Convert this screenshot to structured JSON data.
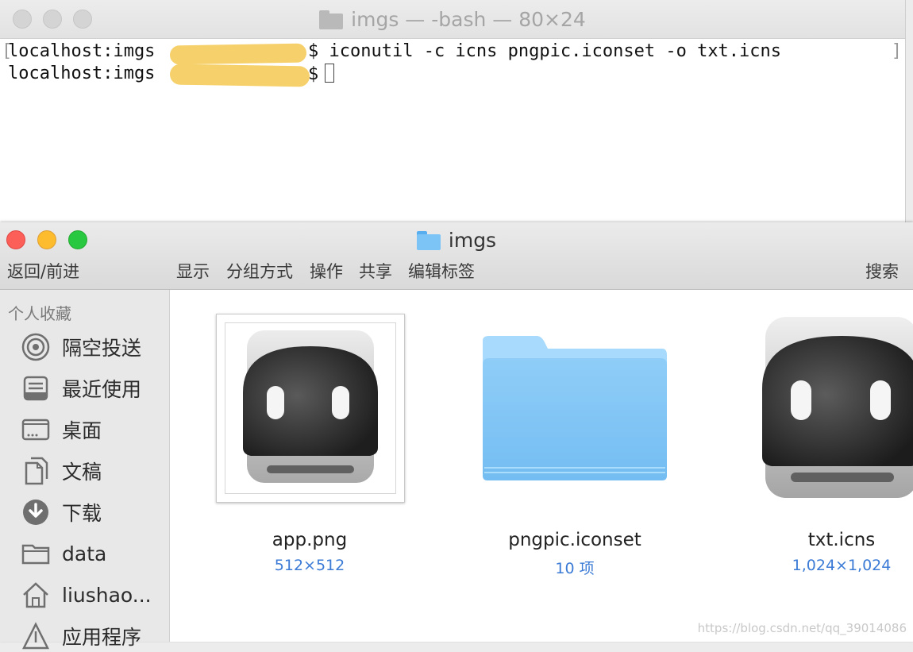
{
  "terminal": {
    "title": "imgs — -bash — 80×24",
    "bracket_left": "[",
    "bracket_right": "]",
    "lines": [
      {
        "prompt": "localhost:imgs",
        "command": "$ iconutil -c icns pngpic.iconset -o txt.icns"
      },
      {
        "prompt": "localhost:imgs",
        "command": "$"
      }
    ]
  },
  "finder": {
    "title": "imgs",
    "toolbar": {
      "back_forward": "返回/前进",
      "view": "显示",
      "group": "分组方式",
      "action": "操作",
      "share": "共享",
      "tags": "编辑标签",
      "search": "搜索"
    },
    "sidebar": {
      "heading": "个人收藏",
      "items": [
        {
          "label": "隔空投送",
          "icon": "airdrop-icon"
        },
        {
          "label": "最近使用",
          "icon": "recents-icon"
        },
        {
          "label": "桌面",
          "icon": "desktop-icon"
        },
        {
          "label": "文稿",
          "icon": "documents-icon"
        },
        {
          "label": "下载",
          "icon": "downloads-icon"
        },
        {
          "label": "data",
          "icon": "folder-icon"
        },
        {
          "label": "liushao...",
          "icon": "home-icon"
        },
        {
          "label": "应用程序",
          "icon": "applications-icon"
        }
      ]
    },
    "files": [
      {
        "name": "app.png",
        "meta": "512×512",
        "icon": "app-png-thumbnail"
      },
      {
        "name": "pngpic.iconset",
        "meta": "10 项",
        "icon": "folder-icon"
      },
      {
        "name": "txt.icns",
        "meta": "1,024×1,024",
        "icon": "icns-icon"
      }
    ]
  },
  "watermark": "https://blog.csdn.net/qq_39014086",
  "colors": {
    "redaction": "#f6d06b",
    "accent_blue": "#3b7bd6",
    "folder_blue": "#7cc4f6"
  }
}
